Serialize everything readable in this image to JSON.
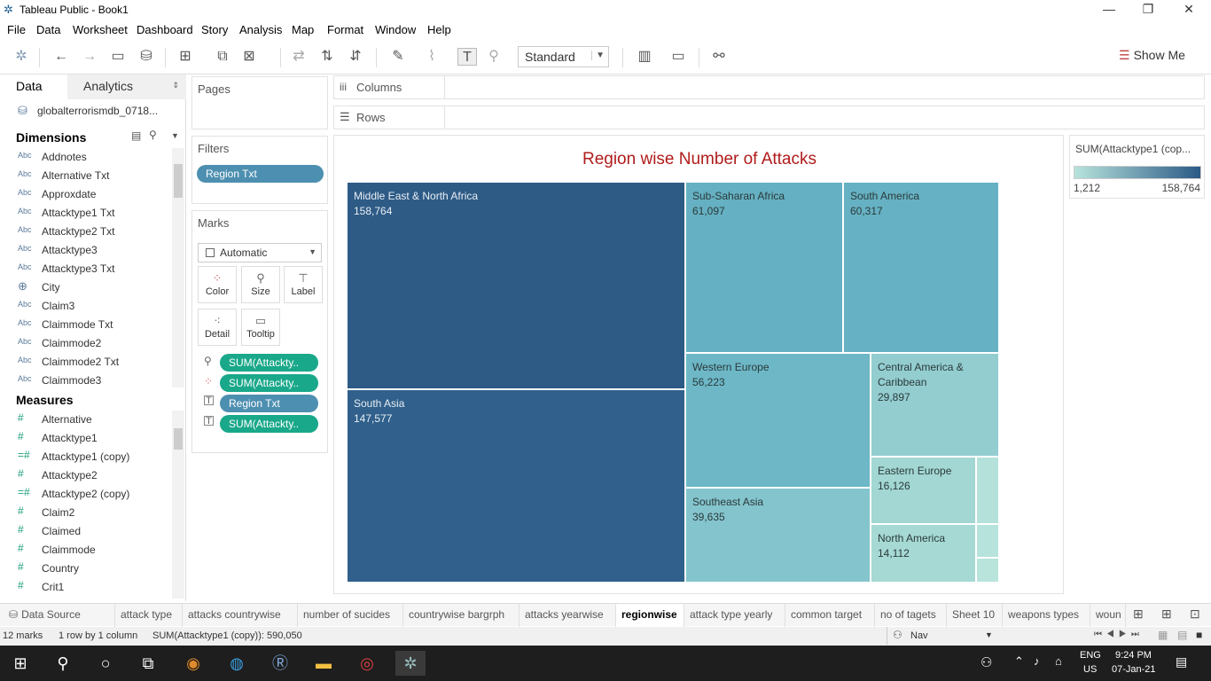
{
  "window": {
    "title": "Tableau Public - Book1",
    "minimize": "—",
    "restore": "❐",
    "close": "✕"
  },
  "menu": [
    "File",
    "Data",
    "Worksheet",
    "Dashboard",
    "Story",
    "Analysis",
    "Map",
    "Format",
    "Window",
    "Help"
  ],
  "toolbar": {
    "fit_select": "Standard",
    "show_me": "Show Me"
  },
  "data_pane": {
    "tab_data": "Data",
    "tab_analytics": "Analytics",
    "datasource": "globalterrorismdb_0718...",
    "dimensions_title": "Dimensions",
    "dimensions": [
      {
        "type": "Abc",
        "name": "Addnotes"
      },
      {
        "type": "Abc",
        "name": "Alternative Txt"
      },
      {
        "type": "Abc",
        "name": "Approxdate"
      },
      {
        "type": "Abc",
        "name": "Attacktype1 Txt"
      },
      {
        "type": "Abc",
        "name": "Attacktype2 Txt"
      },
      {
        "type": "Abc",
        "name": "Attacktype3"
      },
      {
        "type": "Abc",
        "name": "Attacktype3 Txt"
      },
      {
        "type": "globe",
        "name": "City"
      },
      {
        "type": "Abc",
        "name": "Claim3"
      },
      {
        "type": "Abc",
        "name": "Claimmode Txt"
      },
      {
        "type": "Abc",
        "name": "Claimmode2"
      },
      {
        "type": "Abc",
        "name": "Claimmode2 Txt"
      },
      {
        "type": "Abc",
        "name": "Claimmode3"
      }
    ],
    "measures_title": "Measures",
    "measures": [
      {
        "type": "#",
        "name": "Alternative"
      },
      {
        "type": "#",
        "name": "Attacktype1"
      },
      {
        "type": "=#",
        "name": "Attacktype1 (copy)"
      },
      {
        "type": "#",
        "name": "Attacktype2"
      },
      {
        "type": "=#",
        "name": "Attacktype2 (copy)"
      },
      {
        "type": "#",
        "name": "Claim2"
      },
      {
        "type": "#",
        "name": "Claimed"
      },
      {
        "type": "#",
        "name": "Claimmode"
      },
      {
        "type": "#",
        "name": "Country"
      },
      {
        "type": "#",
        "name": "Crit1"
      }
    ]
  },
  "shelves": {
    "pages": "Pages",
    "filters": "Filters",
    "filter_pill": "Region Txt",
    "columns": "Columns",
    "rows": "Rows",
    "marks": "Marks",
    "mark_type": "Automatic",
    "mark_buttons": [
      "Color",
      "Size",
      "Label",
      "Detail",
      "Tooltip"
    ],
    "mark_pills": [
      "SUM(Attackty..",
      "SUM(Attackty..",
      "Region Txt",
      "SUM(Attackty.."
    ]
  },
  "chart_data": {
    "type": "treemap",
    "title": "Region wise Number of Attacks",
    "measure": "SUM(Attacktype1 (copy))",
    "color_range": [
      1212,
      158764
    ],
    "colors": {
      "low": "#b7e3dc",
      "high": "#2b5a86"
    },
    "labels": [
      {
        "region": "Middle East & North Africa",
        "value": "158,764",
        "v": 158764,
        "color": "#2e5b86"
      },
      {
        "region": "South Asia",
        "value": "147,577",
        "v": 147577,
        "color": "#30608b"
      },
      {
        "region": "Sub-Saharan Africa",
        "value": "61,097",
        "v": 61097,
        "color": "#65b0c2"
      },
      {
        "region": "South America",
        "value": "60,317",
        "v": 60317,
        "color": "#66b1c3"
      },
      {
        "region": "Western Europe",
        "value": "56,223",
        "v": 56223,
        "color": "#6db7c7"
      },
      {
        "region": "Southeast Asia",
        "value": "39,635",
        "v": 39635,
        "color": "#84c4cd"
      },
      {
        "region": "Central America & Caribbean",
        "value": "29,897",
        "v": 29897,
        "color": "#93cdd0"
      },
      {
        "region": "Eastern Europe",
        "value": "16,126",
        "v": 16126,
        "color": "#a2d7d3"
      },
      {
        "region": "North America",
        "value": "14,112",
        "v": 14112,
        "color": "#a6d9d4"
      },
      {
        "region": "",
        "value": "",
        "v": null,
        "color": "#b4e2da"
      },
      {
        "region": "",
        "value": "",
        "v": null,
        "color": "#b6e3db"
      },
      {
        "region": "",
        "value": "",
        "v": null,
        "color": "#b8e4dc"
      }
    ]
  },
  "legend": {
    "title": "SUM(Attacktype1 (cop...",
    "min": "1,212",
    "max": "158,764"
  },
  "sheet_tabs": [
    "Data Source",
    "attack type",
    "attacks countrywise",
    "number of sucides",
    "countrywise bargrph",
    "attacks yearwise",
    "regionwise",
    "attack type yearly",
    "common target",
    "no of tagets",
    "Sheet 10",
    "weapons types",
    "woun"
  ],
  "active_tab": "regionwise",
  "status": {
    "marks": "12 marks",
    "dims": "1 row by 1 column",
    "sum": "SUM(Attacktype1 (copy)): 590,050",
    "user": "Nav"
  },
  "taskbar": {
    "lang1": "ENG",
    "lang2": "US",
    "time": "9:24 PM",
    "date": "07-Jan-21"
  }
}
